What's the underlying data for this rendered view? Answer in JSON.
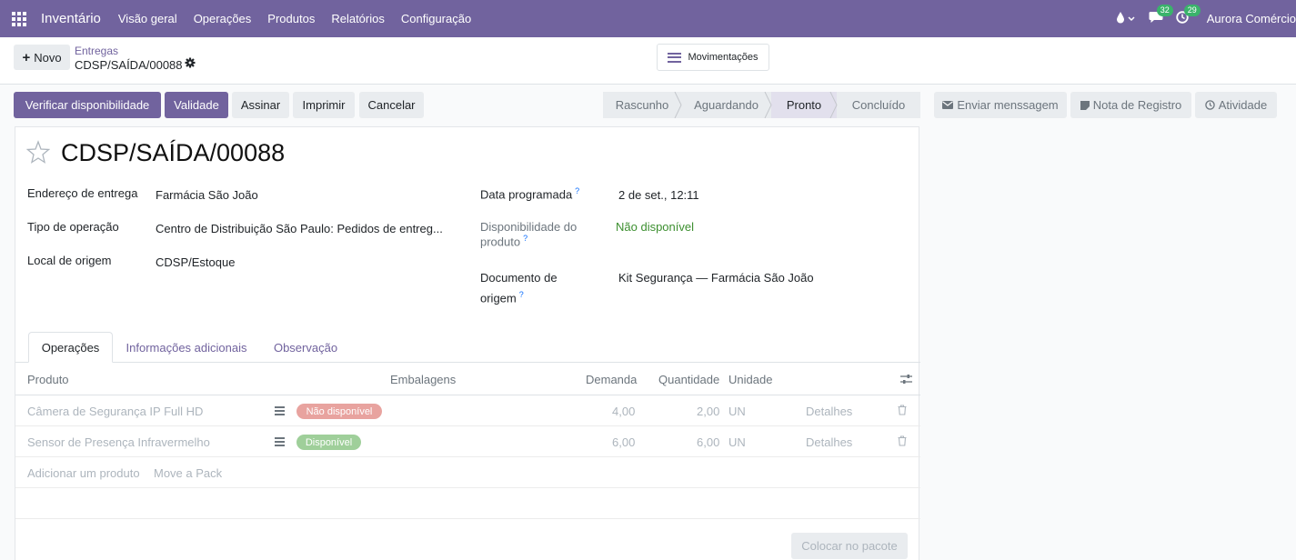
{
  "nav": {
    "app_name": "Inventário",
    "menu": [
      "Visão geral",
      "Operações",
      "Produtos",
      "Relatórios",
      "Configuração"
    ],
    "messages_count": "32",
    "activities_count": "29",
    "company": "Aurora Comércio"
  },
  "control": {
    "new_label": "Novo",
    "breadcrumb_parent": "Entregas",
    "breadcrumb_current": "CDSP/SAÍDA/00088",
    "moves_label": "Movimentações"
  },
  "actions": {
    "check_availability": "Verificar disponibilidade",
    "validate": "Validade",
    "sign": "Assinar",
    "print": "Imprimir",
    "cancel": "Cancelar"
  },
  "status": {
    "steps": [
      "Rascunho",
      "Aguardando",
      "Pronto",
      "Concluído"
    ],
    "active": "Pronto"
  },
  "chatter": {
    "send_message": "Enviar menssagem",
    "log_note": "Nota de Registro",
    "activity": "Atividade"
  },
  "record": {
    "title": "CDSP/SAÍDA/00088",
    "fields_left": [
      {
        "label": "Endereço de entrega",
        "value": "Farmácia São João"
      },
      {
        "label": "Tipo de operação",
        "value": "Centro de Distribuição São Paulo: Pedidos de entreg..."
      },
      {
        "label": "Local de origem",
        "value": "CDSP/Estoque"
      }
    ],
    "scheduled_label": "Data programada",
    "scheduled_value": "2 de set., 12:11",
    "availability_label_1": "Disponibilidade do",
    "availability_label_2": "produto",
    "availability_value": "Não disponível",
    "origin_label_1": "Documento de",
    "origin_label_2": "origem",
    "origin_value": "Kit Segurança — Farmácia São João",
    "help_mark": "?"
  },
  "tabs": [
    "Operações",
    "Informações adicionais",
    "Observação"
  ],
  "table": {
    "headers": {
      "product": "Produto",
      "packaging": "Embalagens",
      "demand": "Demanda",
      "quantity": "Quantidade",
      "unit": "Unidade"
    },
    "rows": [
      {
        "product": "Câmera de Segurança IP Full HD",
        "status": "Não disponível",
        "demand": "4,00",
        "quantity": "2,00",
        "unit": "UN",
        "details": "Detalhes"
      },
      {
        "product": "Sensor de Presença Infravermelho",
        "status": "Disponível",
        "demand": "6,00",
        "quantity": "6,00",
        "unit": "UN",
        "details": "Detalhes"
      }
    ],
    "add_product": "Adicionar um produto",
    "move_pack": "Move a Pack",
    "put_in_pack": "Colocar no pacote"
  }
}
